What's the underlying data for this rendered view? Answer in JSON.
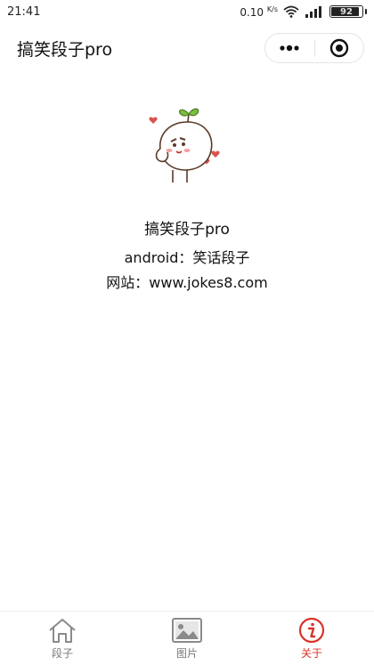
{
  "status_bar": {
    "time": "21:41",
    "speed": "0.10",
    "speed_unit": "K/s",
    "battery": "92",
    "battery_fraction": 0.92
  },
  "nav": {
    "title": "搞笑段子pro",
    "more_icon": "more-dots-icon",
    "close_icon": "target-circle-icon"
  },
  "about": {
    "app_name": "搞笑段子pro",
    "android_line": "android：笑话段子",
    "website_line": "网站：www.jokes8.com"
  },
  "tabs": [
    {
      "label": "段子",
      "icon": "home-icon",
      "active": false
    },
    {
      "label": "图片",
      "icon": "picture-icon",
      "active": false
    },
    {
      "label": "关于",
      "icon": "info-icon",
      "active": true
    }
  ],
  "colors": {
    "accent": "#d8342a",
    "inactive": "#7a7a7a",
    "heart": "#d9534f",
    "sprout": "#7bbf3e"
  }
}
